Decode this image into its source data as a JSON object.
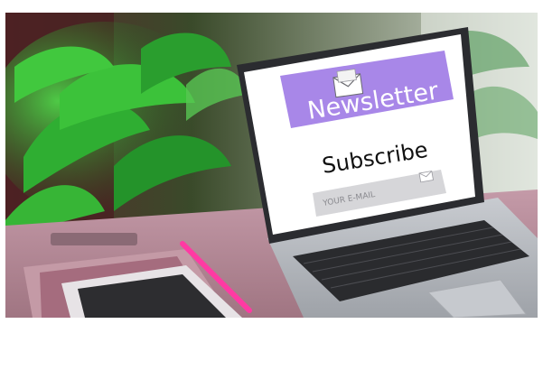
{
  "screen": {
    "banner_title": "Newsletter",
    "heading": "Subscribe",
    "email_placeholder": "YOUR E-MAIL"
  },
  "colors": {
    "banner": "#a887e8",
    "table": "#b58c9a",
    "screen": "#ffffff",
    "laptop_body": "#b9bcc2"
  },
  "icons": [
    "envelope-icon",
    "mail-icon"
  ]
}
